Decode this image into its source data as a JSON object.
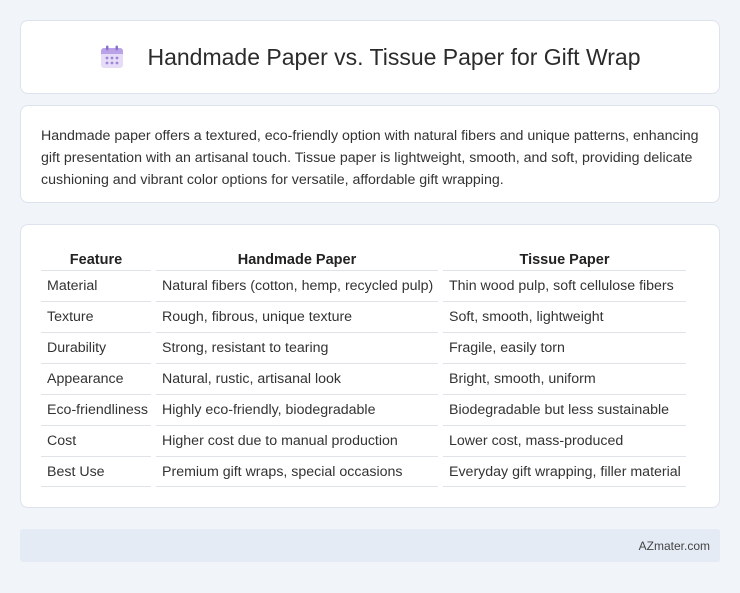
{
  "header": {
    "title": "Handmade Paper vs. Tissue Paper for Gift Wrap",
    "icon": "calendar-icon"
  },
  "description": "Handmade paper offers a textured, eco-friendly option with natural fibers and unique patterns, enhancing gift presentation with an artisanal touch. Tissue paper is lightweight, smooth, and soft, providing delicate cushioning and vibrant color options for versatile, affordable gift wrapping.",
  "table": {
    "headers": [
      "Feature",
      "Handmade Paper",
      "Tissue Paper"
    ],
    "rows": [
      [
        "Material",
        "Natural fibers (cotton, hemp, recycled pulp)",
        "Thin wood pulp, soft cellulose fibers"
      ],
      [
        "Texture",
        "Rough, fibrous, unique texture",
        "Soft, smooth, lightweight"
      ],
      [
        "Durability",
        "Strong, resistant to tearing",
        "Fragile, easily torn"
      ],
      [
        "Appearance",
        "Natural, rustic, artisanal look",
        "Bright, smooth, uniform"
      ],
      [
        "Eco-friendliness",
        "Highly eco-friendly, biodegradable",
        "Biodegradable but less sustainable"
      ],
      [
        "Cost",
        "Higher cost due to manual production",
        "Lower cost, mass-produced"
      ],
      [
        "Best Use",
        "Premium gift wraps, special occasions",
        "Everyday gift wrapping, filler material"
      ]
    ]
  },
  "footer": {
    "source": "AZmater.com"
  },
  "colors": {
    "background": "#f1f4f9",
    "card": "#ffffff",
    "footer": "#e5ebf5",
    "icon_accent": "#b9a2e8"
  }
}
